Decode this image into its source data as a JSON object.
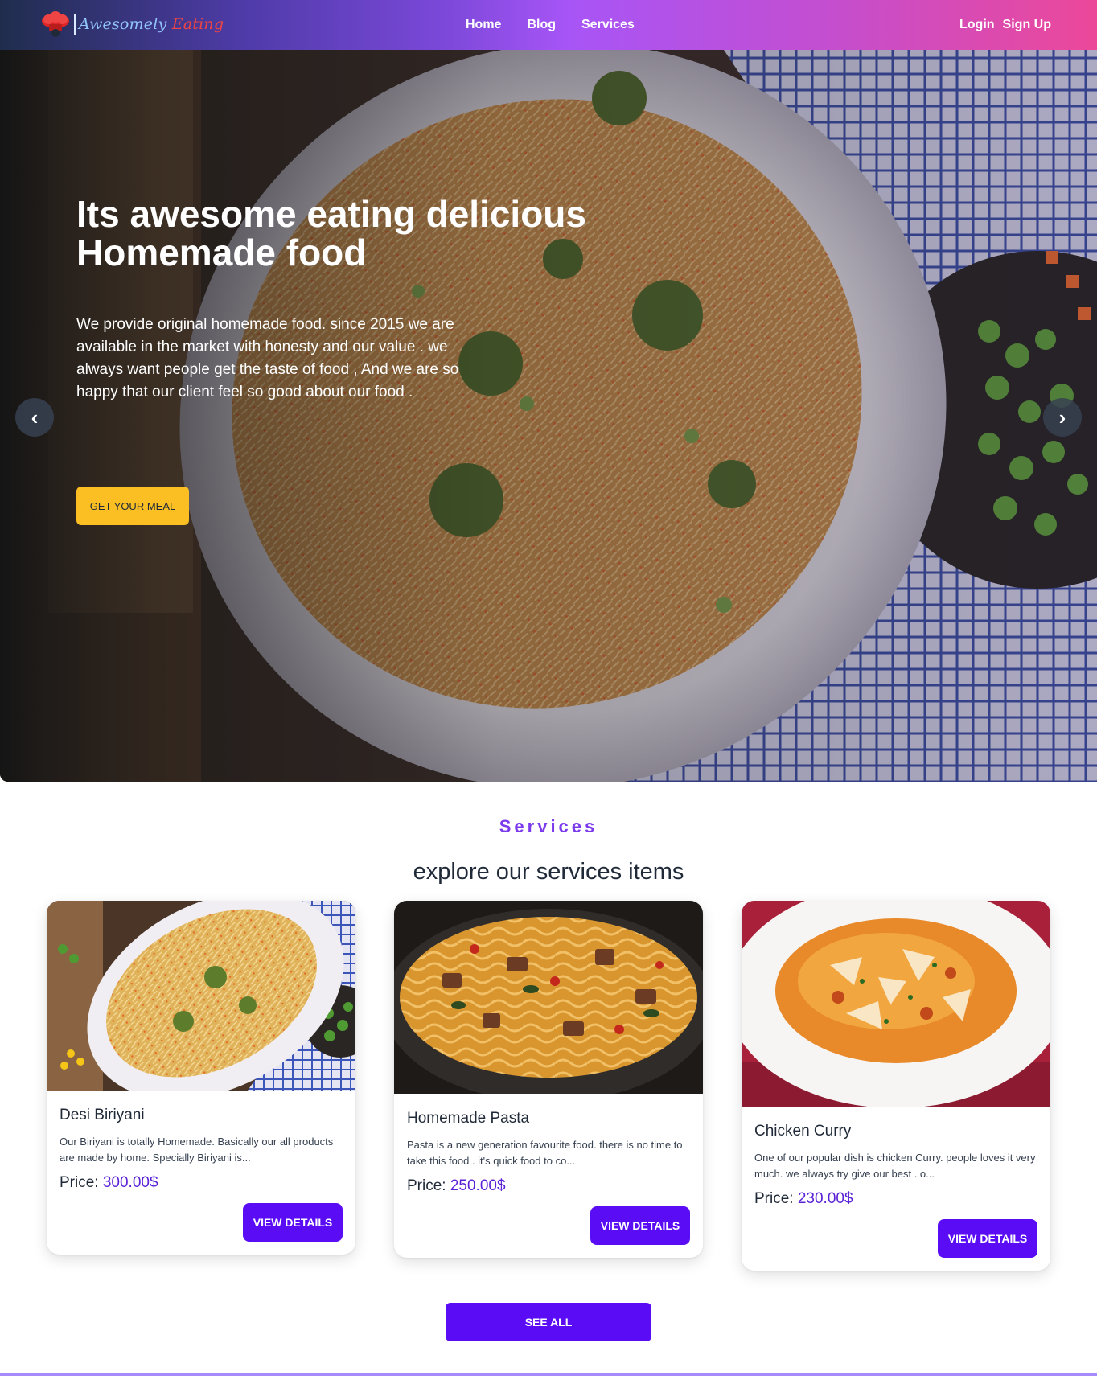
{
  "brand": {
    "name_part1": "Awesomely",
    "name_part2": "Eating",
    "logo_icon": "chef-hat-icon",
    "logo_colors": {
      "part1": "#93c5fd",
      "part2": "#ef4444"
    }
  },
  "nav": {
    "links": [
      "Home",
      "Blog",
      "Services"
    ],
    "login": "Login",
    "signup": "Sign Up"
  },
  "hero": {
    "title": "Its awesome eating delicious Homemade food",
    "text": "We provide original homemade food. since 2015 we are available in the market with honesty and our value . we always want people get the taste of food , And we are so happy that our client feel so good about our food .",
    "button": "GET YOUR MEAL",
    "prev_icon": "chevron-left-icon",
    "next_icon": "chevron-right-icon",
    "button_color": "#fbbf24"
  },
  "services": {
    "eyebrow": "Services",
    "title": "explore our services items",
    "items": [
      {
        "name": "Desi Biriyani",
        "desc": "Our Biriyani is totally Homemade. Basically our all products are made by home. Specially Biriyani is...",
        "price_label": "Price:",
        "price": "300.00$",
        "button": "VIEW DETAILS"
      },
      {
        "name": "Homemade Pasta",
        "desc": "Pasta is a new generation favourite food. there is no time to take this food . it's quick food to co...",
        "price_label": "Price:",
        "price": "250.00$",
        "button": "VIEW DETAILS"
      },
      {
        "name": "Chicken Curry",
        "desc": "One of our popular dish is chicken Curry. people loves it very much. we always try give our best . o...",
        "price_label": "Price:",
        "price": "230.00$",
        "button": "VIEW DETAILS"
      }
    ],
    "see_all": "SEE ALL",
    "accent": "#5a0cf5"
  }
}
